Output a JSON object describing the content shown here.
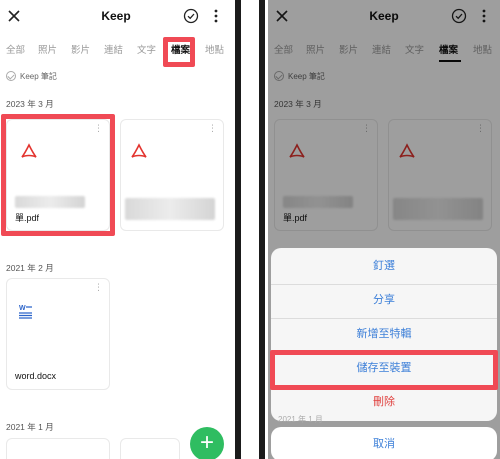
{
  "app": {
    "title": "Keep"
  },
  "tabs": [
    "全部",
    "照片",
    "影片",
    "連結",
    "文字",
    "檔案",
    "地點"
  ],
  "keep_note": "Keep 筆記",
  "sections": [
    {
      "date": "2023 年 3 月"
    },
    {
      "date": "2021 年 2 月"
    },
    {
      "date": "2021 年 1 月"
    }
  ],
  "files": [
    {
      "name": "單.pdf",
      "type": "pdf"
    },
    {
      "name": "",
      "type": "pdf"
    },
    {
      "name": "word.docx",
      "type": "docx"
    }
  ],
  "fab": {
    "label": "+"
  },
  "action_sheet": {
    "items": [
      "釘選",
      "分享",
      "新增至特輯",
      "儲存至裝置",
      "刪除"
    ],
    "cancel": "取消"
  },
  "right_partial_date": "2021 年 1 月",
  "colors": {
    "highlight": "#f04a55",
    "accent": "#2fbd61",
    "link": "#3c7fd8",
    "danger": "#e0403e",
    "pdf": "#e3342f"
  }
}
